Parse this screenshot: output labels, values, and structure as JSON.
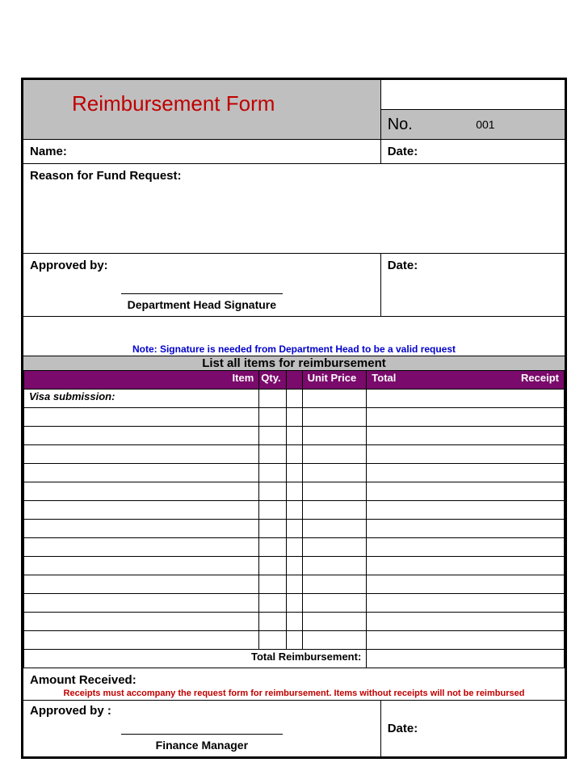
{
  "header": {
    "title": "Reimbursement Form",
    "no_label": "No.",
    "no_value": "001"
  },
  "fields": {
    "name_label": "Name:",
    "date_label": "Date:",
    "reason_label": "Reason for Fund Request:",
    "approved_by_label": "Approved by:",
    "approved_by2_label": "Approved by :",
    "dept_head_sig": "Department Head Signature",
    "finance_mgr": "Finance Manager",
    "note": "Note: Signature is needed from Department Head  to be a valid request",
    "section": "List all items for reimbursement",
    "col_item": "Item",
    "col_qty": "Qty.",
    "col_unit": "Unit Price",
    "col_total": "Total",
    "col_receipt": "Receipt",
    "first_item": "Visa submission:",
    "total_label": "Total Reimbursement:",
    "amount_received": "Amount Received:",
    "red_note": "Receipts must accompany the request form for reimbursement.  Items without receipts will not be reimbursed"
  }
}
